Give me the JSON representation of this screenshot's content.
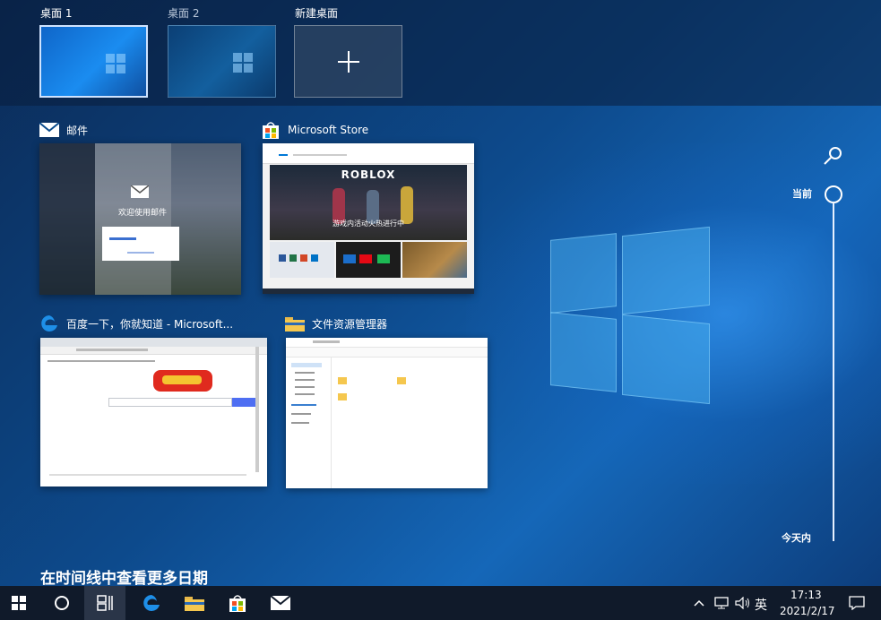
{
  "desktops": [
    {
      "label": "桌面 1",
      "state": "active"
    },
    {
      "label": "桌面 2",
      "state": "inactive"
    },
    {
      "label": "新建桌面",
      "state": "new"
    }
  ],
  "windows": [
    {
      "title": "邮件",
      "icon": "mail-icon"
    },
    {
      "title": "Microsoft Store",
      "icon": "store-icon"
    },
    {
      "title": "百度一下，你就知道 - Microsoft...",
      "icon": "edge-icon"
    },
    {
      "title": "文件资源管理器",
      "icon": "folder-icon"
    }
  ],
  "mail_preview": {
    "welcome": "欢迎使用邮件"
  },
  "store_preview": {
    "game_title": "ROBLOX",
    "caption": "游戏内活动火热进行中"
  },
  "timeline": {
    "current_label": "当前",
    "today_label": "今天内",
    "more_dates": "在时间线中查看更多日期"
  },
  "taskbar": {
    "ime": "英",
    "time": "17:13",
    "date": "2021/2/17"
  },
  "colors": {
    "accent": "#0078d7",
    "taskbar": "#101a2a"
  }
}
